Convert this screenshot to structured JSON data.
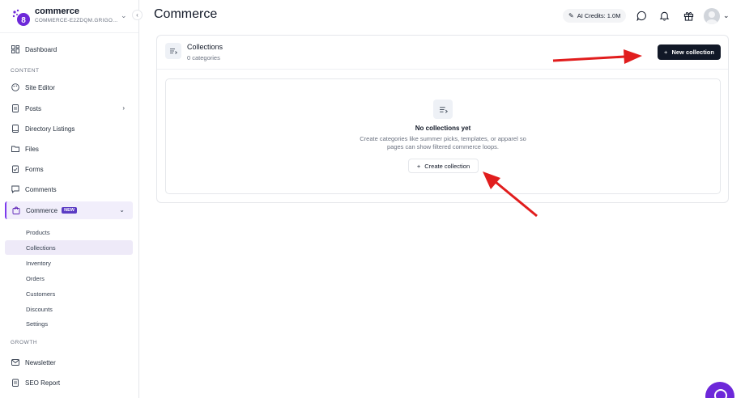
{
  "brand": {
    "name": "commerce",
    "subtitle": "COMMERCE-E2ZDQM.GRIGO..."
  },
  "sidebar": {
    "dashboard": "Dashboard",
    "section_content": "CONTENT",
    "site_editor": "Site Editor",
    "posts": "Posts",
    "directory": "Directory Listings",
    "files": "Files",
    "forms": "Forms",
    "comments": "Comments",
    "commerce": "Commerce",
    "commerce_badge": "NEW",
    "sub_items": [
      "Products",
      "Collections",
      "Inventory",
      "Orders",
      "Customers",
      "Discounts",
      "Settings"
    ],
    "active_sub": "Collections",
    "section_growth": "GROWTH",
    "newsletter": "Newsletter",
    "seo_report": "SEO Report"
  },
  "header": {
    "title": "Commerce",
    "credits": "AI Credits: 1.0M"
  },
  "panel": {
    "title": "Collections",
    "subtitle": "0 categories",
    "new_button": "New collection"
  },
  "empty_state": {
    "title": "No collections yet",
    "description": "Create categories like summer picks, templates, or apparel so pages can show filtered commerce loops.",
    "button": "Create collection"
  },
  "colors": {
    "accent": "#7c3aed",
    "primary_button": "#111827",
    "annotation_arrow": "#e11d1d"
  }
}
